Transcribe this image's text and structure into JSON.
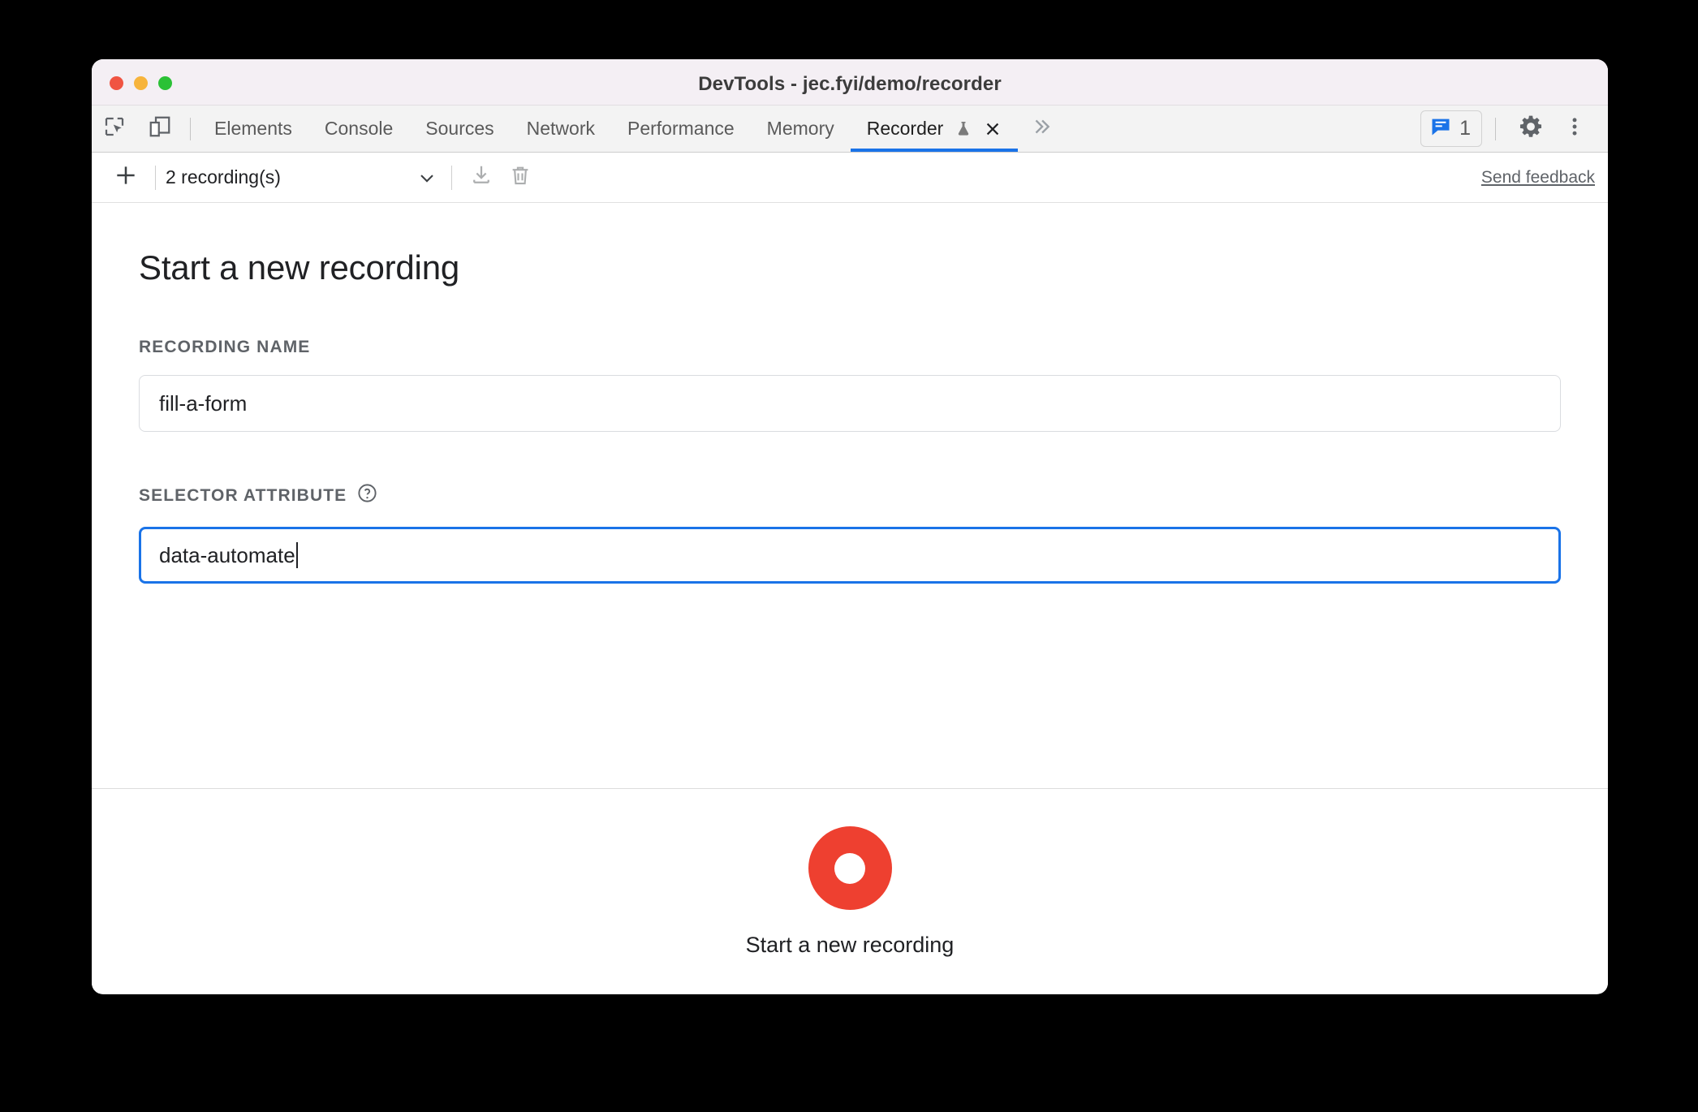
{
  "window": {
    "title": "DevTools - jec.fyi/demo/recorder",
    "traffic_lights": [
      "close",
      "minimize",
      "maximize"
    ]
  },
  "tabbar": {
    "left_icons": [
      {
        "name": "inspect-element-icon"
      },
      {
        "name": "device-toolbar-icon"
      }
    ],
    "tabs": [
      {
        "label": "Elements",
        "active": false
      },
      {
        "label": "Console",
        "active": false
      },
      {
        "label": "Sources",
        "active": false
      },
      {
        "label": "Network",
        "active": false
      },
      {
        "label": "Performance",
        "active": false
      },
      {
        "label": "Memory",
        "active": false
      },
      {
        "label": "Recorder",
        "active": true
      }
    ],
    "recorder_tab": {
      "label": "Recorder",
      "experiment_icon": "flask-icon",
      "close_icon": "close-icon"
    },
    "more_tabs_icon": "chevron-double-right-icon",
    "issues": {
      "icon": "issues-message-icon",
      "count": "1",
      "accent": "#1a73e8"
    },
    "settings_icon": "gear-icon",
    "menu_icon": "kebab-menu-icon"
  },
  "recorder_toolbar": {
    "add_icon": "plus-icon",
    "selected_recording": "2 recording(s)",
    "caret_icon": "chevron-down-icon",
    "import_icon": "download-icon",
    "delete_icon": "trash-icon",
    "feedback_label": "Send feedback"
  },
  "main": {
    "title": "Start a new recording",
    "fields": [
      {
        "label": "RECORDING NAME",
        "value": "fill-a-form",
        "placeholder": "Recording name",
        "focused": false,
        "help": false
      },
      {
        "label": "SELECTOR ATTRIBUTE",
        "value": "data-automate",
        "placeholder": "Selector attribute",
        "focused": true,
        "help": true,
        "help_icon": "help-circle-icon"
      }
    ]
  },
  "footer": {
    "record_icon": "record-circle-icon",
    "record_color": "#ee4030",
    "label": "Start a new recording"
  }
}
